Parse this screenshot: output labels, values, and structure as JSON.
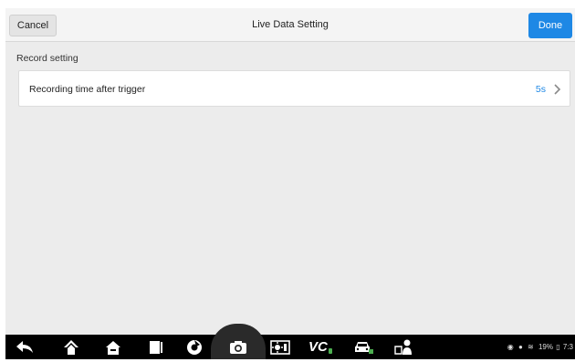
{
  "header": {
    "cancel_label": "Cancel",
    "title": "Live Data Setting",
    "done_label": "Done"
  },
  "section": {
    "label": "Record setting"
  },
  "settings_row": {
    "label": "Recording time after trigger",
    "value": "5s"
  },
  "navbar": {
    "icons": [
      "back-icon",
      "home-up-icon",
      "home-icon",
      "recent-apps-icon",
      "browser-icon",
      "camera-icon",
      "display-icon",
      "vci-icon",
      "vehicle-icon",
      "user-icon"
    ],
    "vci_label": "VC"
  },
  "status_bar": {
    "battery": "19%",
    "time": "7:3"
  },
  "colors": {
    "accent": "#1e88e5",
    "background": "#ececec",
    "navbar": "#000000"
  }
}
